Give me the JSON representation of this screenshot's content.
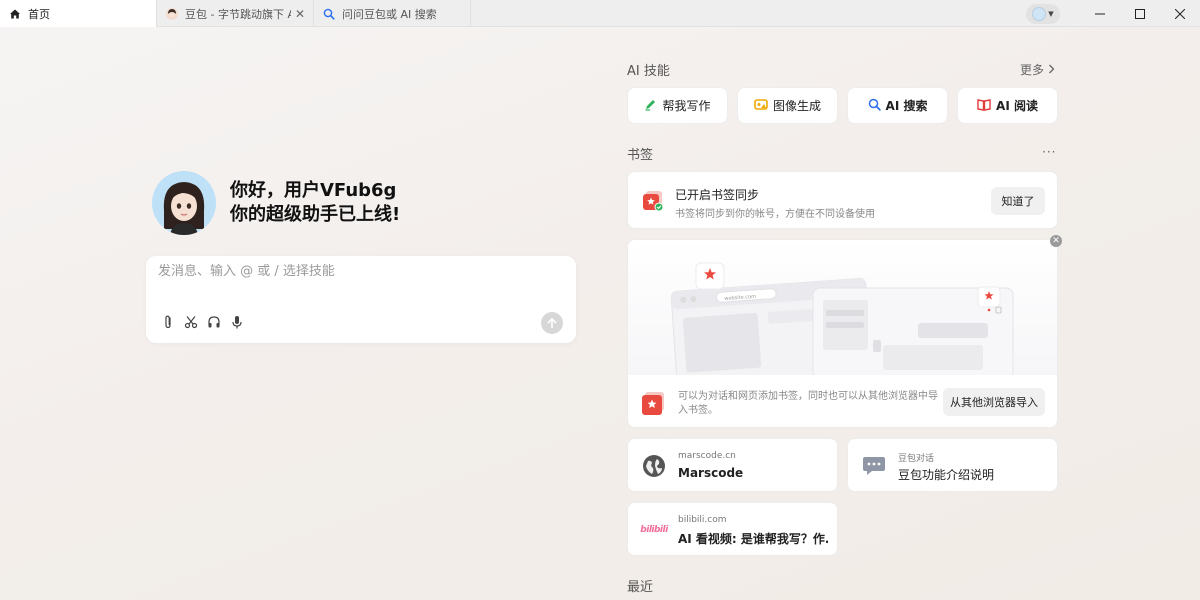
{
  "tabs": [
    {
      "label": "首页",
      "icon": "home-icon",
      "active": true
    },
    {
      "label": "豆包 - 字节跳动旗下 AI",
      "icon": "doubao-avatar-icon",
      "active": false
    },
    {
      "label": "问问豆包或 AI 搜索",
      "icon": "ai-search-icon",
      "active": false
    }
  ],
  "greeting": {
    "line1": "你好，用户VFub6g",
    "line2": "你的超级助手已上线!"
  },
  "chat": {
    "placeholder": "发消息、输入 @ 或 / 选择技能"
  },
  "ai_skills": {
    "title": "AI 技能",
    "more": "更多",
    "items": [
      {
        "label": "帮我写作",
        "icon": "pen-icon",
        "color": "#2fb35a"
      },
      {
        "label": "图像生成",
        "icon": "image-gen-icon",
        "color": "#f0a800"
      },
      {
        "label": "AI 搜索",
        "icon": "ai-search-icon",
        "color": "#2b6ff0"
      },
      {
        "label": "AI 阅读",
        "icon": "book-icon",
        "color": "#e23c3c"
      }
    ]
  },
  "bookmarks": {
    "title": "书签",
    "more_dots": "···",
    "sync": {
      "title": "已开启书签同步",
      "subtitle": "书签将同步到你的帐号，方便在不同设备使用",
      "button": "知道了"
    },
    "illustration": {
      "url_text": "website.com"
    },
    "import": {
      "text": "可以为对话和网页添加书签，同时也可以从其他浏览器中导入书签。",
      "button": "从其他浏览器导入"
    },
    "sites": [
      {
        "domain": "marscode.cn",
        "title": "Marscode",
        "icon": "globe-icon"
      },
      {
        "domain": "豆包对话",
        "title": "豆包功能介绍说明",
        "icon": "chat-bubble-icon"
      },
      {
        "domain": "bilibili.com",
        "title": "AI 看视频: 是谁帮我写？作...",
        "icon": "bilibili-icon",
        "icon_text": "bilibili"
      }
    ]
  },
  "recent": {
    "title": "最近"
  },
  "colors": {
    "accent_red": "#e84a3f",
    "bilibili_pink": "#f06c9a"
  }
}
